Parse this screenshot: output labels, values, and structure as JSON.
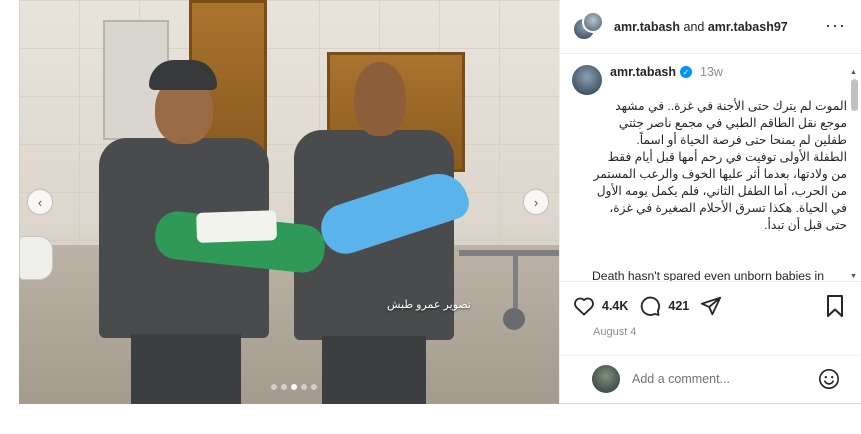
{
  "header": {
    "user1": "amr.tabash",
    "conjunction": "and",
    "user2": "amr.tabash97",
    "more_icon": "more-horizontal-icon"
  },
  "media": {
    "watermark": "تصوير عمرو طبش",
    "prev_icon": "chevron-left-icon",
    "next_icon": "chevron-right-icon",
    "slide_count": 5,
    "active_slide": 2
  },
  "caption": {
    "username": "amr.tabash",
    "time": "13w",
    "text_ar": "الموت لم يترك حتى الأجنة في غزة.. في مشهد موجع نقل الطاقم الطبي في مجمع ناصر جثتي طفلين لم يمنحا حتى فرصة الحياة أو اسماً.\nالطفلة الأولى توفيت في رحم أمها قبل أيام فقط من ولادتها، بعدما أثر عليها الخوف والرعب المستمر من الحرب، أما الطفل الثاني، فلم يكمل يومه الأول في الحياة. هكذا تسرق الأحلام الصغيرة في غزة، حتى قبل أن تبدأ.",
    "text_en": "Death hasn't spared even unborn babies in Gaza..."
  },
  "actions": {
    "likes": "4.4K",
    "comments": "421",
    "date": "August 4"
  },
  "comment_bar": {
    "placeholder": "Add a comment..."
  },
  "colors": {
    "verified": "#0095f6",
    "muted": "#8e8e8e",
    "text": "#262626"
  }
}
